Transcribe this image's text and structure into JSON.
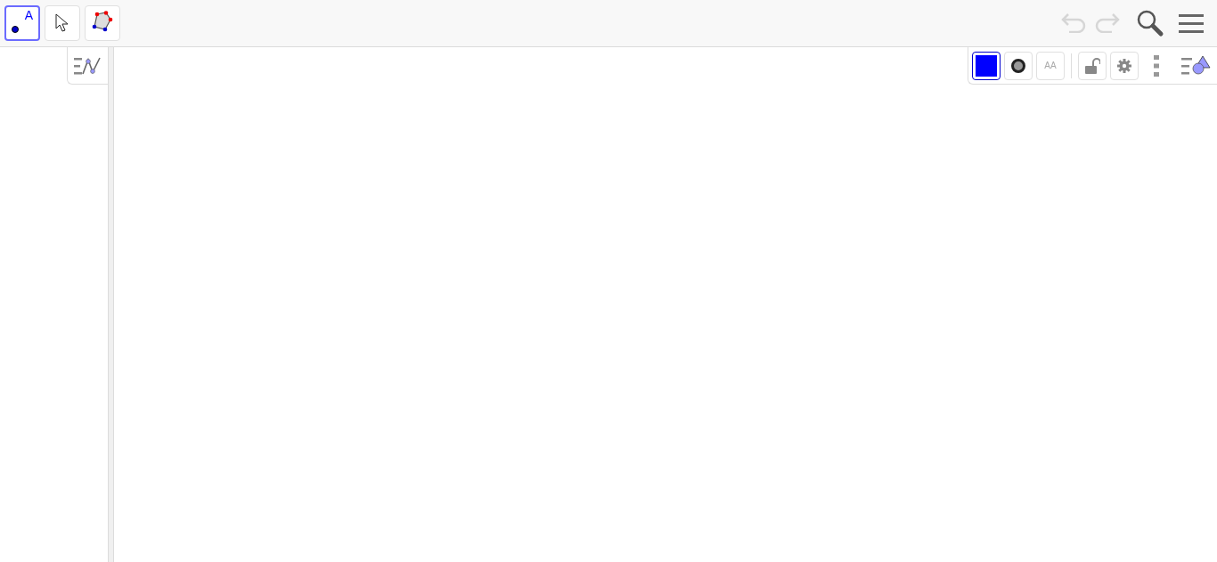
{
  "toolbar": {
    "tools": [
      {
        "kind": "point",
        "glyph": "A",
        "selected": true
      },
      {
        "kind": "move",
        "selected": false
      },
      {
        "kind": "polygon",
        "selected": false
      }
    ],
    "undo": {
      "disabled": true
    },
    "redo": {
      "disabled": true
    }
  },
  "style_bar": {
    "color": "#0000ff",
    "text_style_glyph": "AA",
    "locked": false
  }
}
